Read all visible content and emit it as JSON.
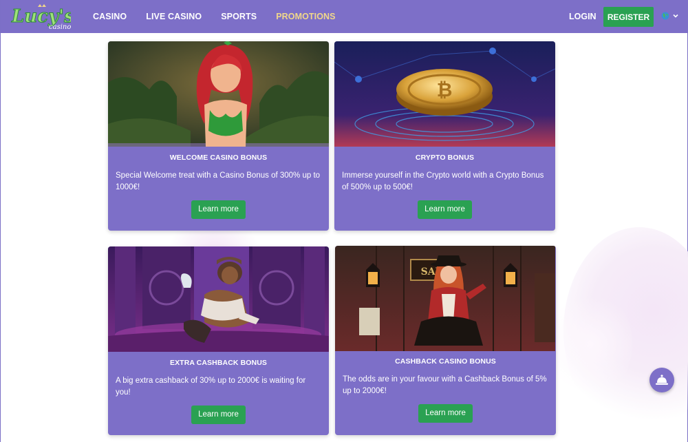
{
  "brand": {
    "logo_text": "Lucy's",
    "logo_sub": "casino"
  },
  "nav": [
    {
      "label": "CASINO",
      "active": false
    },
    {
      "label": "LIVE CASINO",
      "active": false
    },
    {
      "label": "SPORTS",
      "active": false
    },
    {
      "label": "PROMOTIONS",
      "active": true
    }
  ],
  "header": {
    "login_label": "LOGIN",
    "register_label": "REGISTER",
    "language_icon": "globe-icon"
  },
  "promotions": [
    {
      "title": "WELCOME CASINO BONUS",
      "description": "Special Welcome treat with a Casino Bonus of 300% up to 1000€!",
      "button": "Learn more"
    },
    {
      "title": "CRYPTO BONUS",
      "description": "Immerse yourself in the Crypto world with a Crypto Bonus of 500% up to 500€!",
      "button": "Learn more"
    },
    {
      "title": "EXTRA CASHBACK BONUS",
      "description": "A big extra cashback of 30% up to 2000€ is waiting for you!",
      "button": "Learn more"
    },
    {
      "title": "CASHBACK CASINO BONUS",
      "description": "The odds are in your favour with a Cashback Bonus of 5% up to 2000€!",
      "button": "Learn more"
    }
  ],
  "colors": {
    "header": "#7d6fc8",
    "card": "#7d6fc8",
    "cta": "#2aa152",
    "active_nav": "#f0d78a"
  },
  "support": {
    "icon": "service-bell-icon"
  }
}
